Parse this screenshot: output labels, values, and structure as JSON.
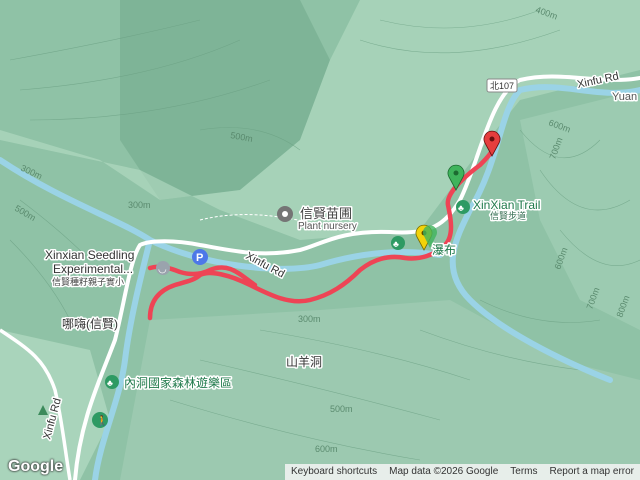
{
  "map": {
    "places": {
      "nursery": {
        "name_zh": "信賢苗圃",
        "name_en": "Plant nursery"
      },
      "experimental": {
        "name_en_1": "Xinxian Seedling",
        "name_en_2": "Experimental...",
        "name_zh": "信賢種籽親子實小"
      },
      "trail": {
        "name_en": "XinXian Trail",
        "name_zh": "信賢步道"
      },
      "waterfall": {
        "name_zh_partial": "瀑布"
      },
      "forest_park": {
        "name_zh": "內洞國家森林遊樂區"
      },
      "nalu": {
        "name_zh": "哪嗨(信賢)"
      },
      "shanyangdong": {
        "name_zh": "山羊洞"
      },
      "yuan_edge": {
        "name_en": "Yuan"
      }
    },
    "roads": {
      "xinfu_center": "Xinfu Rd",
      "xinfu_northeast": "Xinfu Rd",
      "xinfu_west": "Xinfu Rd",
      "route_shield": "北107"
    },
    "contour_labels": [
      "400m",
      "500m",
      "300m",
      "300m",
      "300m",
      "500m",
      "600m",
      "600m",
      "700m",
      "700m",
      "500m",
      "600m",
      "800m"
    ],
    "parking_symbol": "P",
    "colors": {
      "terrain": "#8fc2a6",
      "ridge_light": "#c7e6d2",
      "river": "#9ad3e6",
      "road": "#ffffff",
      "track": "#ee4455",
      "poi_green": "#2e9a63",
      "parking_blue": "#4d78e8",
      "marker_red": "#e53e3e",
      "marker_green": "#3fb45c",
      "marker_yellow": "#f2d20a"
    },
    "markers": {
      "start": {
        "color": "red-pin"
      },
      "waypoint": {
        "color": "green-pin"
      },
      "end": {
        "color": "yellow-pin"
      }
    }
  },
  "attribution": {
    "logo": "Google",
    "keyboard": "Keyboard shortcuts",
    "mapdata": "Map data ©2026 Google",
    "terms": "Terms",
    "report": "Report a map error"
  }
}
